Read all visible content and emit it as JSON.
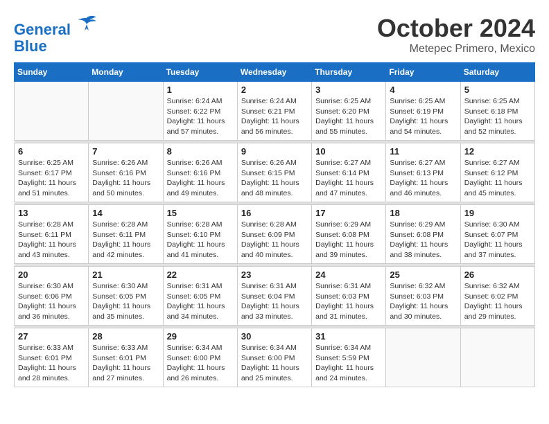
{
  "header": {
    "logo_line1": "General",
    "logo_line2": "Blue",
    "month": "October 2024",
    "location": "Metepec Primero, Mexico"
  },
  "days_of_week": [
    "Sunday",
    "Monday",
    "Tuesday",
    "Wednesday",
    "Thursday",
    "Friday",
    "Saturday"
  ],
  "weeks": [
    [
      {
        "day": "",
        "info": ""
      },
      {
        "day": "",
        "info": ""
      },
      {
        "day": "1",
        "info": "Sunrise: 6:24 AM\nSunset: 6:22 PM\nDaylight: 11 hours and 57 minutes."
      },
      {
        "day": "2",
        "info": "Sunrise: 6:24 AM\nSunset: 6:21 PM\nDaylight: 11 hours and 56 minutes."
      },
      {
        "day": "3",
        "info": "Sunrise: 6:25 AM\nSunset: 6:20 PM\nDaylight: 11 hours and 55 minutes."
      },
      {
        "day": "4",
        "info": "Sunrise: 6:25 AM\nSunset: 6:19 PM\nDaylight: 11 hours and 54 minutes."
      },
      {
        "day": "5",
        "info": "Sunrise: 6:25 AM\nSunset: 6:18 PM\nDaylight: 11 hours and 52 minutes."
      }
    ],
    [
      {
        "day": "6",
        "info": "Sunrise: 6:25 AM\nSunset: 6:17 PM\nDaylight: 11 hours and 51 minutes."
      },
      {
        "day": "7",
        "info": "Sunrise: 6:26 AM\nSunset: 6:16 PM\nDaylight: 11 hours and 50 minutes."
      },
      {
        "day": "8",
        "info": "Sunrise: 6:26 AM\nSunset: 6:16 PM\nDaylight: 11 hours and 49 minutes."
      },
      {
        "day": "9",
        "info": "Sunrise: 6:26 AM\nSunset: 6:15 PM\nDaylight: 11 hours and 48 minutes."
      },
      {
        "day": "10",
        "info": "Sunrise: 6:27 AM\nSunset: 6:14 PM\nDaylight: 11 hours and 47 minutes."
      },
      {
        "day": "11",
        "info": "Sunrise: 6:27 AM\nSunset: 6:13 PM\nDaylight: 11 hours and 46 minutes."
      },
      {
        "day": "12",
        "info": "Sunrise: 6:27 AM\nSunset: 6:12 PM\nDaylight: 11 hours and 45 minutes."
      }
    ],
    [
      {
        "day": "13",
        "info": "Sunrise: 6:28 AM\nSunset: 6:11 PM\nDaylight: 11 hours and 43 minutes."
      },
      {
        "day": "14",
        "info": "Sunrise: 6:28 AM\nSunset: 6:11 PM\nDaylight: 11 hours and 42 minutes."
      },
      {
        "day": "15",
        "info": "Sunrise: 6:28 AM\nSunset: 6:10 PM\nDaylight: 11 hours and 41 minutes."
      },
      {
        "day": "16",
        "info": "Sunrise: 6:28 AM\nSunset: 6:09 PM\nDaylight: 11 hours and 40 minutes."
      },
      {
        "day": "17",
        "info": "Sunrise: 6:29 AM\nSunset: 6:08 PM\nDaylight: 11 hours and 39 minutes."
      },
      {
        "day": "18",
        "info": "Sunrise: 6:29 AM\nSunset: 6:08 PM\nDaylight: 11 hours and 38 minutes."
      },
      {
        "day": "19",
        "info": "Sunrise: 6:30 AM\nSunset: 6:07 PM\nDaylight: 11 hours and 37 minutes."
      }
    ],
    [
      {
        "day": "20",
        "info": "Sunrise: 6:30 AM\nSunset: 6:06 PM\nDaylight: 11 hours and 36 minutes."
      },
      {
        "day": "21",
        "info": "Sunrise: 6:30 AM\nSunset: 6:05 PM\nDaylight: 11 hours and 35 minutes."
      },
      {
        "day": "22",
        "info": "Sunrise: 6:31 AM\nSunset: 6:05 PM\nDaylight: 11 hours and 34 minutes."
      },
      {
        "day": "23",
        "info": "Sunrise: 6:31 AM\nSunset: 6:04 PM\nDaylight: 11 hours and 33 minutes."
      },
      {
        "day": "24",
        "info": "Sunrise: 6:31 AM\nSunset: 6:03 PM\nDaylight: 11 hours and 31 minutes."
      },
      {
        "day": "25",
        "info": "Sunrise: 6:32 AM\nSunset: 6:03 PM\nDaylight: 11 hours and 30 minutes."
      },
      {
        "day": "26",
        "info": "Sunrise: 6:32 AM\nSunset: 6:02 PM\nDaylight: 11 hours and 29 minutes."
      }
    ],
    [
      {
        "day": "27",
        "info": "Sunrise: 6:33 AM\nSunset: 6:01 PM\nDaylight: 11 hours and 28 minutes."
      },
      {
        "day": "28",
        "info": "Sunrise: 6:33 AM\nSunset: 6:01 PM\nDaylight: 11 hours and 27 minutes."
      },
      {
        "day": "29",
        "info": "Sunrise: 6:34 AM\nSunset: 6:00 PM\nDaylight: 11 hours and 26 minutes."
      },
      {
        "day": "30",
        "info": "Sunrise: 6:34 AM\nSunset: 6:00 PM\nDaylight: 11 hours and 25 minutes."
      },
      {
        "day": "31",
        "info": "Sunrise: 6:34 AM\nSunset: 5:59 PM\nDaylight: 11 hours and 24 minutes."
      },
      {
        "day": "",
        "info": ""
      },
      {
        "day": "",
        "info": ""
      }
    ]
  ]
}
